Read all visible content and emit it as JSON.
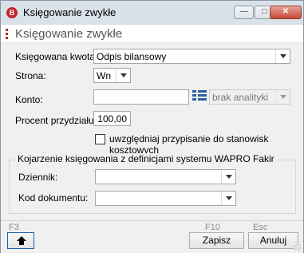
{
  "window": {
    "title": "Księgowanie zwykłe",
    "app_icon_letter": "B",
    "header_title": "Księgowanie zwykłe",
    "controls": {
      "minimize": "—",
      "maximize": "□",
      "close": "✕"
    }
  },
  "form": {
    "kwota_label": "Księgowana kwota:",
    "kwota_value": "Odpis bilansowy",
    "strona_label": "Strona:",
    "strona_value": "Wn",
    "konto_label": "Konto:",
    "konto_value": "",
    "analityka_value": "brak analityki",
    "procent_label": "Procent przydziału:",
    "procent_value": "100,00",
    "checkbox_label": "uwzględniaj przypisanie do stanowisk kosztowych",
    "checkbox_checked": false
  },
  "group": {
    "title": "Kojarzenie księgowania z definicjami systemu WAPRO Fakir",
    "dziennik_label": "Dziennik:",
    "dziennik_value": "",
    "kod_label": "Kod dokumentu:",
    "kod_value": ""
  },
  "footer": {
    "f3_hint": "F3",
    "f10_hint": "F10",
    "esc_hint": "Esc",
    "save_label": "Zapisz",
    "cancel_label": "Anuluj"
  },
  "colors": {
    "accent_red": "#c4262e",
    "titlebar": "#d9e1e9",
    "focus_blue": "#1c5aa8"
  }
}
